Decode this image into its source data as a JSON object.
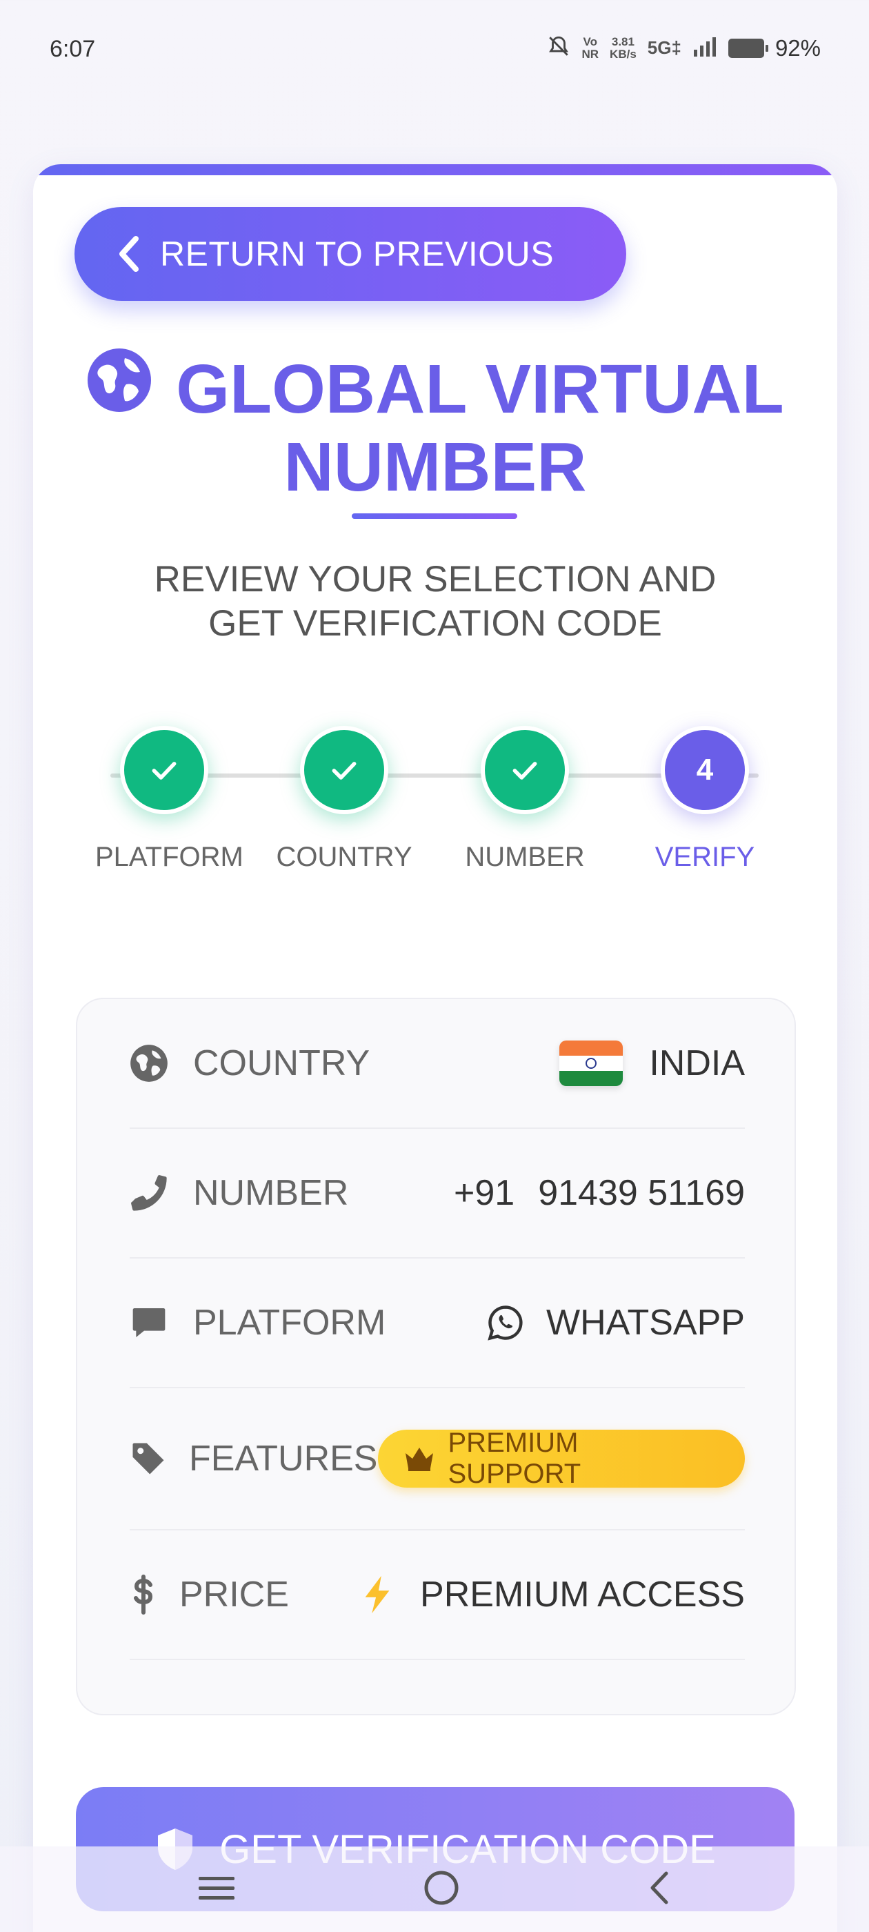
{
  "status_bar": {
    "time": "6:07",
    "volte_top": "Vo",
    "volte_bottom": "NR",
    "speed_top": "3.81",
    "speed_bottom": "KB/s",
    "network": "5G‡",
    "battery_percent": "92%"
  },
  "back_button": {
    "label": "RETURN TO PREVIOUS",
    "icon": "chevron-left-icon"
  },
  "header": {
    "title_line1": "GLOBAL VIRTUAL",
    "title_line2": "NUMBER",
    "subtitle_line1": "REVIEW YOUR SELECTION AND",
    "subtitle_line2": "GET VERIFICATION CODE",
    "icon": "globe-icon"
  },
  "stepper": {
    "steps": [
      {
        "label": "PLATFORM",
        "state": "done"
      },
      {
        "label": "COUNTRY",
        "state": "done"
      },
      {
        "label": "NUMBER",
        "state": "done"
      },
      {
        "label": "VERIFY",
        "state": "active",
        "number": "4"
      }
    ]
  },
  "details": {
    "country": {
      "label": "COUNTRY",
      "value": "INDIA",
      "icon": "globe-icon",
      "flag": "india-flag"
    },
    "number": {
      "label": "NUMBER",
      "code": "+91",
      "value": "91439 51169",
      "icon": "phone-icon"
    },
    "platform": {
      "label": "PLATFORM",
      "value": "WHATSAPP",
      "icon": "chat-icon",
      "value_icon": "whatsapp-icon"
    },
    "features": {
      "label": "FEATURES",
      "value": "PREMIUM SUPPORT",
      "icon": "tag-icon",
      "value_icon": "crown-icon"
    },
    "price": {
      "label": "PRICE",
      "value": "PREMIUM ACCESS",
      "icon": "dollar-icon",
      "value_icon": "bolt-icon"
    }
  },
  "cta": {
    "label": "GET VERIFICATION CODE",
    "icon": "shield-icon"
  },
  "colors": {
    "primary": "#6a5ee8",
    "success": "#10b981",
    "premium": "#fbbf24"
  }
}
